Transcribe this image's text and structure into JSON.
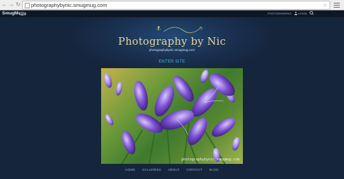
{
  "browser": {
    "url": "photographybynic.smugmug.com",
    "icons": [
      "back-arrow-icon",
      "forward-arrow-icon",
      "reload-icon",
      "page-icon",
      "bookmark-star-icon",
      "menu-icon"
    ]
  },
  "smugmug_bar": {
    "logo": "SmugMug",
    "badge": "PRO",
    "links": {
      "photosharing": "PHOTOSHARING",
      "login": "LOGIN"
    }
  },
  "site": {
    "title": "Photography by Nic",
    "subtitle": "photographybynic.smugmug.com",
    "enter_label": "ENTER SITE"
  },
  "photo": {
    "subject": "purple agapanthus flowers",
    "watermark": "photographybynic.smugmug.com"
  },
  "footer_nav": [
    "HOME",
    "GALLERIES",
    "ABOUT",
    "CONTACT",
    "BLOG"
  ],
  "colors": {
    "background": "#152238",
    "title": "#e7d79a",
    "enter_link": "#4fb6d8",
    "footer_link": "#9fb0c2"
  }
}
